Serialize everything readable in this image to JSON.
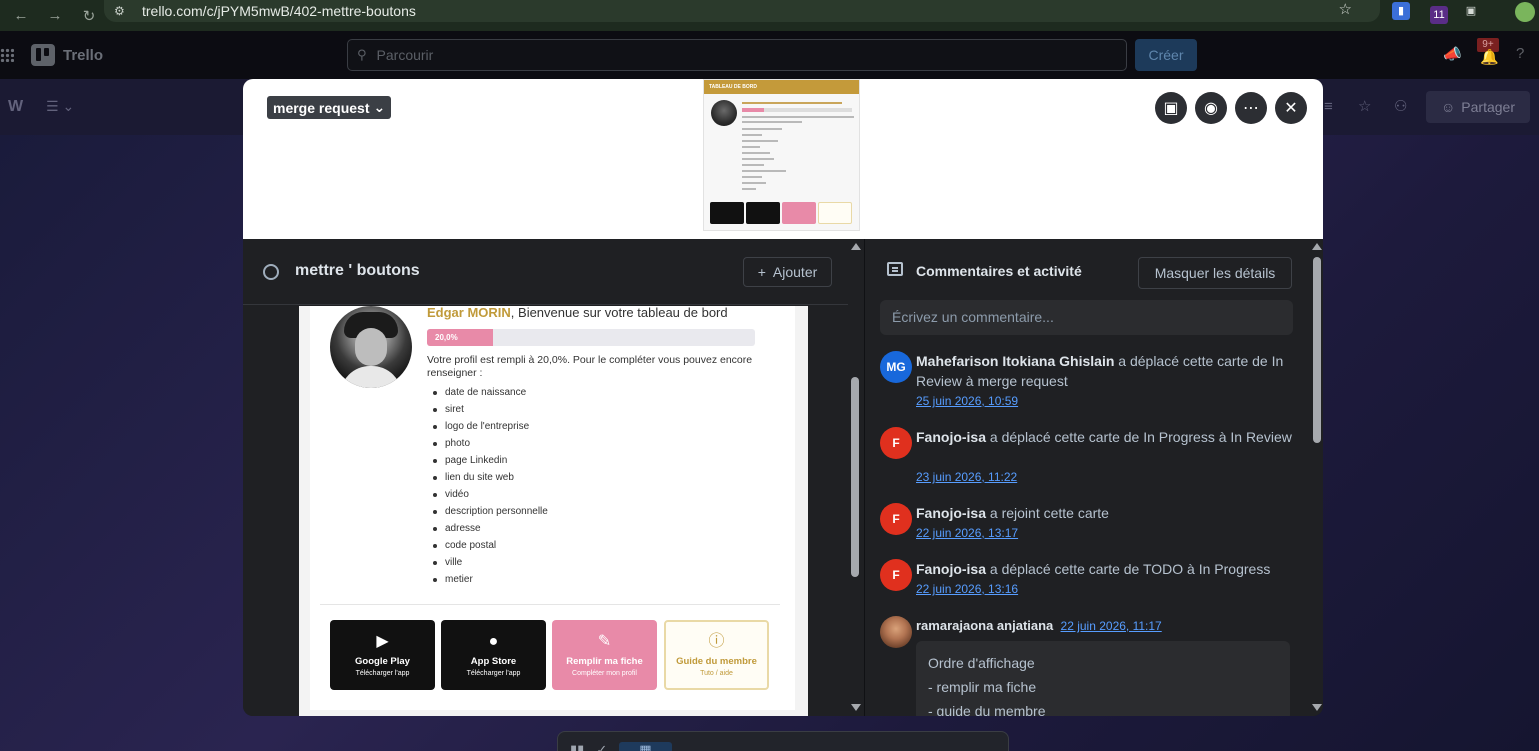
{
  "browser": {
    "url": "trello.com/c/jPYM5mwB/402-mettre-boutons",
    "extension_badge": "11"
  },
  "header": {
    "brand": "Trello",
    "search_placeholder": "Parcourir",
    "create_label": "Créer",
    "notification_badge": "9+"
  },
  "board": {
    "workspace_initial": "W",
    "share_label": "Partager"
  },
  "card": {
    "list_name": "merge request",
    "title": "mettre ' boutons",
    "add_label": "Ajouter"
  },
  "cover_thumb": {
    "title": "TABLEAU DE BORD"
  },
  "screenshot": {
    "user_name": "Edgar MORIN",
    "welcome_suffix": ", Bienvenue sur votre tableau de bord",
    "progress_label": "20,0%",
    "progress_fraction": 0.2,
    "profile_text": "Votre profil est rempli à 20,0%. Pour le compléter vous pouvez encore renseigner :",
    "missing_fields": [
      "date de naissance",
      "siret",
      "logo de l'entreprise",
      "photo",
      "page Linkedin",
      "lien du site web",
      "vidéo",
      "description personnelle",
      "adresse",
      "code postal",
      "ville",
      "metier"
    ],
    "buttons": [
      {
        "title": "Google Play",
        "subtitle": "Télécharger l'app"
      },
      {
        "title": "App Store",
        "subtitle": "Télécharger l'app"
      },
      {
        "title": "Remplir ma fiche",
        "subtitle": "Compléter mon profil"
      },
      {
        "title": "Guide du membre",
        "subtitle": "Tuto / aide"
      }
    ]
  },
  "activity": {
    "title": "Commentaires et activité",
    "hide_details_label": "Masquer les détails",
    "comment_placeholder": "Écrivez un commentaire...",
    "items": [
      {
        "initials": "MG",
        "author": "Mahefarison Itokiana Ghislain",
        "action": " a déplacé cette carte de In Review à merge request",
        "when": "25 juin 2026, 10:59",
        "color": "#1868db"
      },
      {
        "initials": "F",
        "author": "Fanojo-isa",
        "action": " a déplacé cette carte de In Progress à In Review",
        "when": "23 juin 2026, 11:22",
        "color": "#e0301e"
      },
      {
        "initials": "F",
        "author": "Fanojo-isa",
        "action": " a rejoint cette carte",
        "when": "22 juin 2026, 13:17",
        "color": "#e0301e"
      },
      {
        "initials": "F",
        "author": "Fanojo-isa",
        "action": " a déplacé cette carte de TODO à In Progress",
        "when": "22 juin 2026, 13:16",
        "color": "#e0301e"
      }
    ],
    "comment": {
      "author": "ramarajaona anjatiana",
      "when": "22 juin 2026, 11:17",
      "lines": [
        "Ordre d'affichage",
        "- remplir ma fiche",
        "- guide du membre"
      ]
    }
  }
}
